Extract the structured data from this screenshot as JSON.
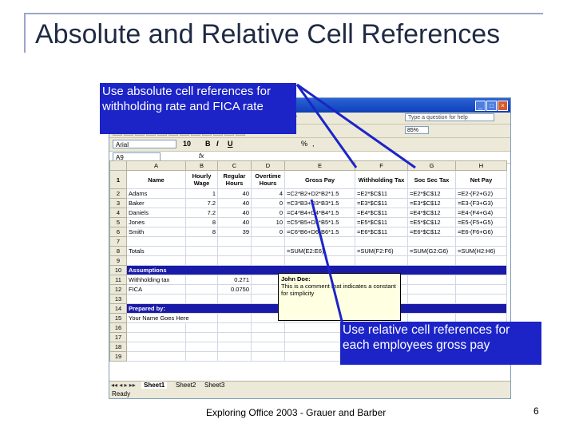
{
  "slide": {
    "title": "Absolute and Relative Cell References",
    "footer": "Exploring Office 2003 - Grauer and Barber",
    "page_number": "6"
  },
  "callouts": {
    "absolute": "Use absolute cell references for withholding rate and FICA rate",
    "relative": "Use relative cell references for each employees gross pay"
  },
  "excel": {
    "menu_fragment": "r",
    "help_placeholder": "Type a question for help",
    "zoom": "85%",
    "font_name": "Arial",
    "font_size": "10",
    "bold": "B",
    "italic": "I",
    "underline": "U",
    "percent": "%",
    "comma": ",",
    "name_box": "A9",
    "fx": "fx",
    "columns": [
      "A",
      "B",
      "C",
      "D",
      "E",
      "F",
      "G",
      "H"
    ],
    "headers": [
      "Name",
      "Hourly Wage",
      "Regular Hours",
      "Overtime Hours",
      "Gross Pay",
      "Withholding Tax",
      "Soc Sec Tax",
      "Net Pay"
    ],
    "rows": [
      {
        "n": "2",
        "cells": [
          "Adams",
          "1",
          "40",
          "4",
          "=C2*B2+D2*B2*1.5",
          "=E2*$C$11",
          "=E2*$C$12",
          "=E2-(F2+G2)"
        ]
      },
      {
        "n": "3",
        "cells": [
          "Baker",
          "7.2",
          "40",
          "0",
          "=C3*B3+D3*B3*1.5",
          "=E3*$C$11",
          "=E3*$C$12",
          "=E3-(F3+G3)"
        ]
      },
      {
        "n": "4",
        "cells": [
          "Daniels",
          "7.2",
          "40",
          "0",
          "=C4*B4+D4*B4*1.5",
          "=E4*$C$11",
          "=E4*$C$12",
          "=E4-(F4+G4)"
        ]
      },
      {
        "n": "5",
        "cells": [
          "Jones",
          "8",
          "40",
          "10",
          "=C5*B5+D5*B5*1.5",
          "=E5*$C$11",
          "=E5*$C$12",
          "=E5-(F5+G5)"
        ]
      },
      {
        "n": "6",
        "cells": [
          "Smith",
          "8",
          "39",
          "0",
          "=C6*B6+D6*B6*1.5",
          "=E6*$C$11",
          "=E6*$C$12",
          "=E6-(F6+G6)"
        ]
      }
    ],
    "totals_label": "Totals",
    "totals": [
      "=SUM(E2:E6)",
      "=SUM(F2:F6)",
      "=SUM(G2:G6)",
      "=SUM(H2:H6)"
    ],
    "assumptions_label": "Assumptions",
    "withholding_label": "Withholding tax",
    "withholding_value": "0.271",
    "fica_label": "FICA",
    "fica_value": "0.0750",
    "prepared_label": "Prepared by:",
    "prepared_value": "Your Name Goes Here",
    "comment_author": "John Doe:",
    "comment_text": "This is a comment that indicates a constant for simplicity",
    "sheets": [
      "Sheet1",
      "Sheet2",
      "Sheet3"
    ],
    "status": "Ready"
  }
}
